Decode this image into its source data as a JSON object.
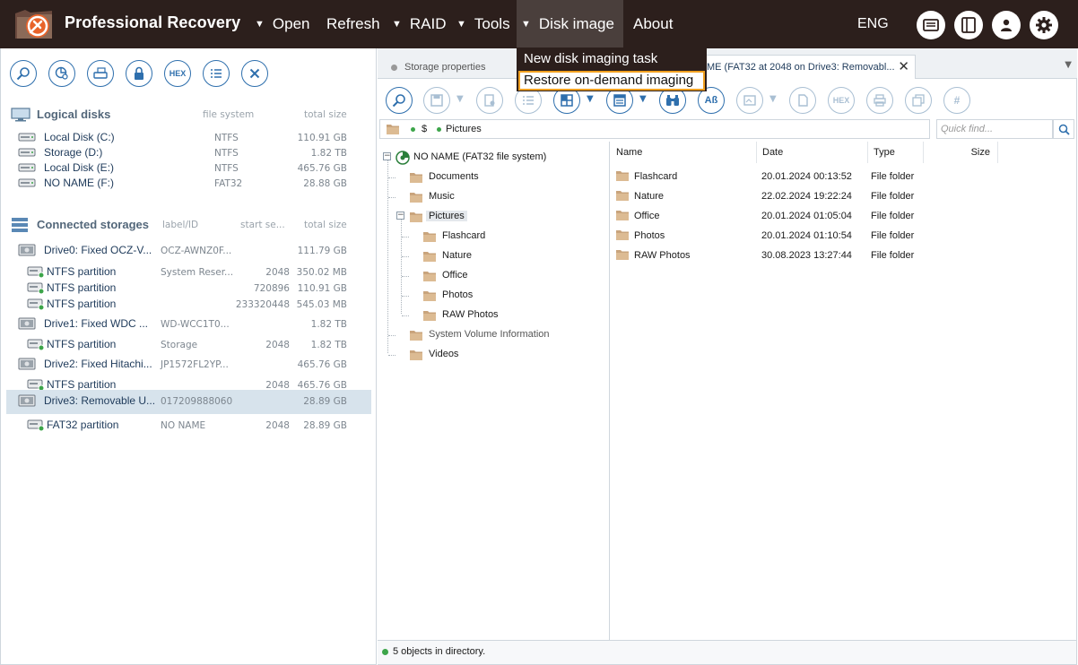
{
  "app": {
    "title": "Professional Recovery",
    "lang": "ENG"
  },
  "menu": {
    "items": [
      {
        "label": "Open",
        "arrow": true
      },
      {
        "label": "Refresh",
        "arrow": false
      },
      {
        "label": "RAID",
        "arrow": true
      },
      {
        "label": "Tools",
        "arrow": true
      },
      {
        "label": "Disk image",
        "arrow": true,
        "active": true
      },
      {
        "label": "About",
        "arrow": false
      }
    ],
    "arrow_glyph": "▼"
  },
  "dropdown": {
    "items": [
      "New disk imaging task",
      "Restore on-demand imaging"
    ],
    "selected": 1
  },
  "left_toolbar": {
    "hex_label": "HEX"
  },
  "logical": {
    "title": "Logical disks",
    "col_fs": "file system",
    "col_size": "total size",
    "rows": [
      {
        "name": "Local Disk (C:)",
        "fs": "NTFS",
        "size": "110.91 GB"
      },
      {
        "name": "Storage (D:)",
        "fs": "NTFS",
        "size": "1.82 TB"
      },
      {
        "name": "Local Disk (E:)",
        "fs": "NTFS",
        "size": "465.76 GB"
      },
      {
        "name": "NO NAME (F:)",
        "fs": "FAT32",
        "size": "28.88 GB"
      }
    ]
  },
  "storages": {
    "title": "Connected storages",
    "col_label": "label/ID",
    "col_start": "start se...",
    "col_size": "total size",
    "rows": [
      {
        "name": "Drive0: Fixed OCZ-V...",
        "label": "OCZ-AWNZ0F...",
        "start": "",
        "size": "111.79 GB",
        "kind": "drive"
      },
      {
        "name": "NTFS partition",
        "label": "System Reser...",
        "start": "2048",
        "size": "350.02 MB",
        "kind": "part"
      },
      {
        "name": "NTFS partition",
        "label": "",
        "start": "720896",
        "size": "110.91 GB",
        "kind": "part"
      },
      {
        "name": "NTFS partition",
        "label": "",
        "start": "233320448",
        "size": "545.03 MB",
        "kind": "part"
      },
      {
        "name": "Drive1: Fixed WDC ...",
        "label": "WD-WCC1T0...",
        "start": "",
        "size": "1.82 TB",
        "kind": "drive"
      },
      {
        "name": "NTFS partition",
        "label": "Storage",
        "start": "2048",
        "size": "1.82 TB",
        "kind": "part"
      },
      {
        "name": "Drive2: Fixed Hitachi...",
        "label": "JP1572FL2YP...",
        "start": "",
        "size": "465.76 GB",
        "kind": "drive"
      },
      {
        "name": "NTFS partition",
        "label": "",
        "start": "2048",
        "size": "465.76 GB",
        "kind": "part"
      },
      {
        "name": "Drive3: Removable U...",
        "label": "017209888060",
        "start": "",
        "size": "28.89 GB",
        "kind": "drive",
        "selected": true
      },
      {
        "name": "FAT32 partition",
        "label": "NO NAME",
        "start": "2048",
        "size": "28.89 GB",
        "kind": "part"
      }
    ]
  },
  "tabs": {
    "tab1": "Storage properties",
    "tab2": "ME (FAT32 at 2048 on Drive3: Removabl..."
  },
  "right_toolbar": {
    "hex_label": "HEX",
    "ab_label": "Aß",
    "hash_label": "#"
  },
  "path": {
    "root": "$",
    "folder": "Pictures"
  },
  "find": {
    "placeholder": "Quick find..."
  },
  "tree": {
    "root": "NO NAME (FAT32 file system)",
    "nodes": [
      {
        "label": "Documents",
        "level": 1
      },
      {
        "label": "Music",
        "level": 1
      },
      {
        "label": "Pictures",
        "level": 1,
        "selected": true,
        "expanded": true
      },
      {
        "label": "Flashcard",
        "level": 2
      },
      {
        "label": "Nature",
        "level": 2
      },
      {
        "label": "Office",
        "level": 2
      },
      {
        "label": "Photos",
        "level": 2
      },
      {
        "label": "RAW Photos",
        "level": 2
      },
      {
        "label": "System Volume Information",
        "level": 1,
        "dim": true
      },
      {
        "label": "Videos",
        "level": 1
      }
    ]
  },
  "list": {
    "columns": [
      "Name",
      "Date",
      "Type",
      "Size"
    ],
    "rows": [
      {
        "name": "Flashcard",
        "date": "20.01.2024 00:13:52",
        "type": "File folder"
      },
      {
        "name": "Nature",
        "date": "22.02.2024 19:22:24",
        "type": "File folder"
      },
      {
        "name": "Office",
        "date": "20.01.2024 01:05:04",
        "type": "File folder"
      },
      {
        "name": "Photos",
        "date": "20.01.2024 01:10:54",
        "type": "File folder"
      },
      {
        "name": "RAW Photos",
        "date": "30.08.2023 13:27:44",
        "type": "File folder"
      }
    ]
  },
  "status": {
    "text": "5 objects in directory."
  },
  "colors": {
    "titlebar": "#2c1f1c",
    "accent": "#2e6fad",
    "highlight": "#f0a020",
    "ok": "#3da54a",
    "folder": "#c9a47c"
  }
}
